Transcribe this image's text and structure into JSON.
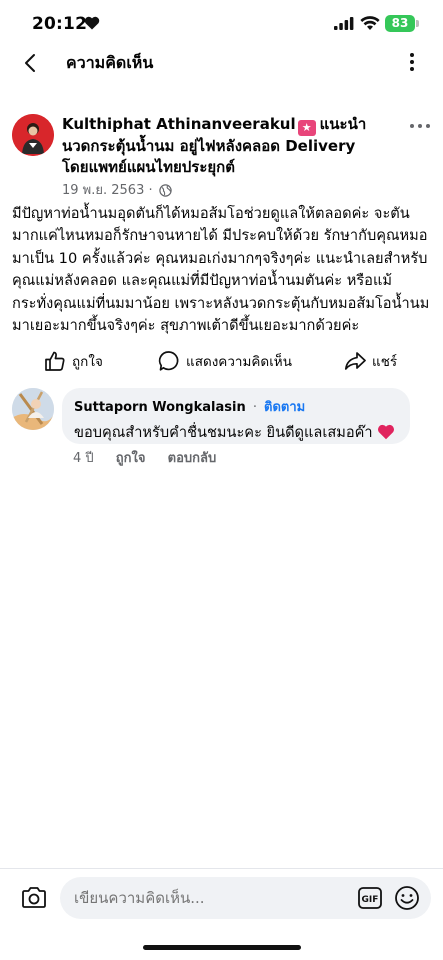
{
  "status_bar": {
    "time": "20:12",
    "battery": "83"
  },
  "header": {
    "title": "ความคิดเห็น"
  },
  "post": {
    "author": "Kulthiphat Athinanveerakul",
    "title": "แนะนำ นวดกระตุ้นน้ำนม อยู่ไฟหลังคลอด Delivery โดยแพทย์แผนไทยประยุกต์",
    "date": "19 พ.ย. 2563",
    "body": "มีปัญหาท่อน้ำนมอุดตันก็ได้หมอส้มโอช่วยดูแลให้ตลอดค่ะ จะตันมากแค่ไหนหมอก็รักษาจนหายได้ มีประคบให้ด้วย รักษากับคุณหมอมาเป็น 10 ครั้งแล้วค่ะ คุณหมอเก่งมากๆจริงๆค่ะ แนะนำเลยสำหรับคุณแม่หลังคลอด และคุณแม่ที่มีปัญหาท่อน้ำนมตันค่ะ หรือแม้กระทั่งคุณแม่ที่นมมาน้อย เพราะหลังนวดกระตุ้นกับหมอส้มโอน้ำนมมาเยอะมากขึ้นจริงๆค่ะ สุขภาพเต้าดีขึ้นเยอะมากด้วยค่ะ"
  },
  "actions": {
    "like": "ถูกใจ",
    "comment": "แสดงความคิดเห็น",
    "share": "แชร์"
  },
  "comment": {
    "author": "Suttaporn Wongkalasin",
    "follow": "ติดตาม",
    "text": "ขอบคุณสำหรับคำชื่นชมนะคะ ยินดีดูแลเสมอค๊า",
    "time": "4 ปี",
    "like": "ถูกใจ",
    "reply": "ตอบกลับ"
  },
  "composer": {
    "placeholder": "เขียนความคิดเห็น...",
    "gif": "GIF"
  },
  "colors": {
    "accent": "#1877f2",
    "badge": "#e8457a",
    "battery": "#35c759"
  }
}
